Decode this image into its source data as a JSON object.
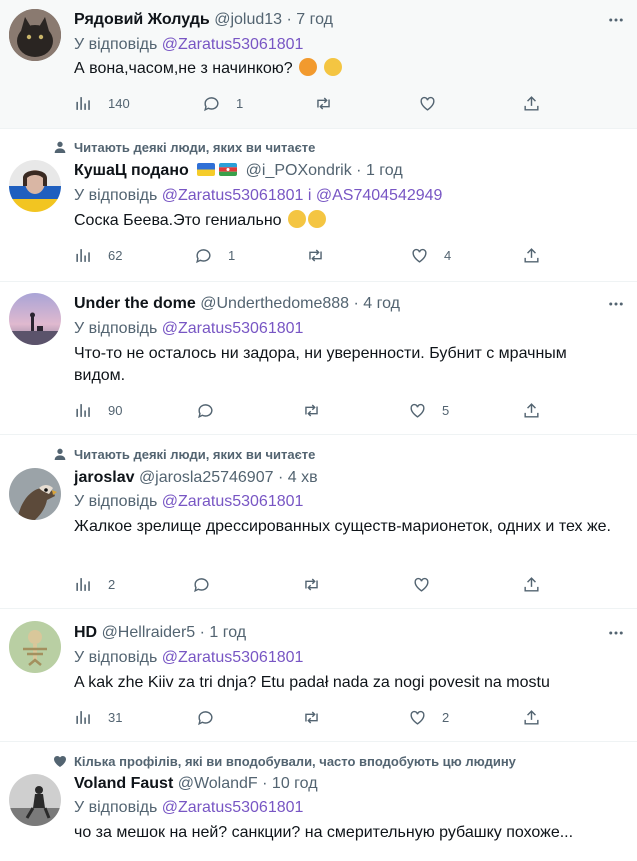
{
  "tweets": [
    {
      "social": "",
      "name": "Рядовий Жолудь",
      "handle": "@jolud13",
      "time": "7 год",
      "reply_prefix": "У відповідь",
      "mentions": "@Zaratus53061801",
      "text": "А вона,часом,не з начинкою?",
      "views": "140",
      "replies": "1",
      "retweets": "",
      "likes": ""
    },
    {
      "social": "Читають деякі люди, яких ви читаєте",
      "name": "КушаЦ подано",
      "handle": "@i_POXondrik",
      "time": "1 год",
      "reply_prefix": "У відповідь",
      "mentions": "@Zaratus53061801 і @AS7404542949",
      "text": "Соска Беева.Это гениально",
      "views": "62",
      "replies": "1",
      "retweets": "",
      "likes": "4"
    },
    {
      "social": "",
      "name": "Under the dome",
      "handle": "@Underthedome888",
      "time": "4 год",
      "reply_prefix": "У відповідь",
      "mentions": "@Zaratus53061801",
      "text": "Что-то не осталось ни задора, ни уверенности. Бубнит с мрачным видом.",
      "views": "90",
      "replies": "",
      "retweets": "",
      "likes": "5"
    },
    {
      "social": "Читають деякі люди, яких ви читаєте",
      "name": "jaroslav",
      "handle": "@jarosla25746907",
      "time": "4 хв",
      "reply_prefix": "У відповідь",
      "mentions": "@Zaratus53061801",
      "text": "Жалкое зрелище дрессированных существ-марионеток, одних и тех же.",
      "views": "2",
      "replies": "",
      "retweets": "",
      "likes": ""
    },
    {
      "social": "",
      "name": "HD",
      "handle": "@Hellraider5",
      "time": "1 год",
      "reply_prefix": "У відповідь",
      "mentions": "@Zaratus53061801",
      "text": "A kak zhe Kiiv za tri dnja? Etu padał nada za nogi povesit na mostu",
      "views": "31",
      "replies": "",
      "retweets": "",
      "likes": "2"
    },
    {
      "social": "Кілька профілів, які ви вподобували, часто вподобують цю людину",
      "name": "Voland Faust",
      "handle": "@WolandF",
      "time": "10 год",
      "reply_prefix": "У відповідь",
      "mentions": "@Zaratus53061801",
      "text": "чо за мешок на ней? санкции? на смерительную рубашку похоже...",
      "views": "",
      "replies": "",
      "retweets": "",
      "likes": ""
    }
  ],
  "sep": " · ",
  "colors": {
    "accent": "#7856c4",
    "secondary": "#536471",
    "highlight_bg": "#f7f9f9"
  }
}
